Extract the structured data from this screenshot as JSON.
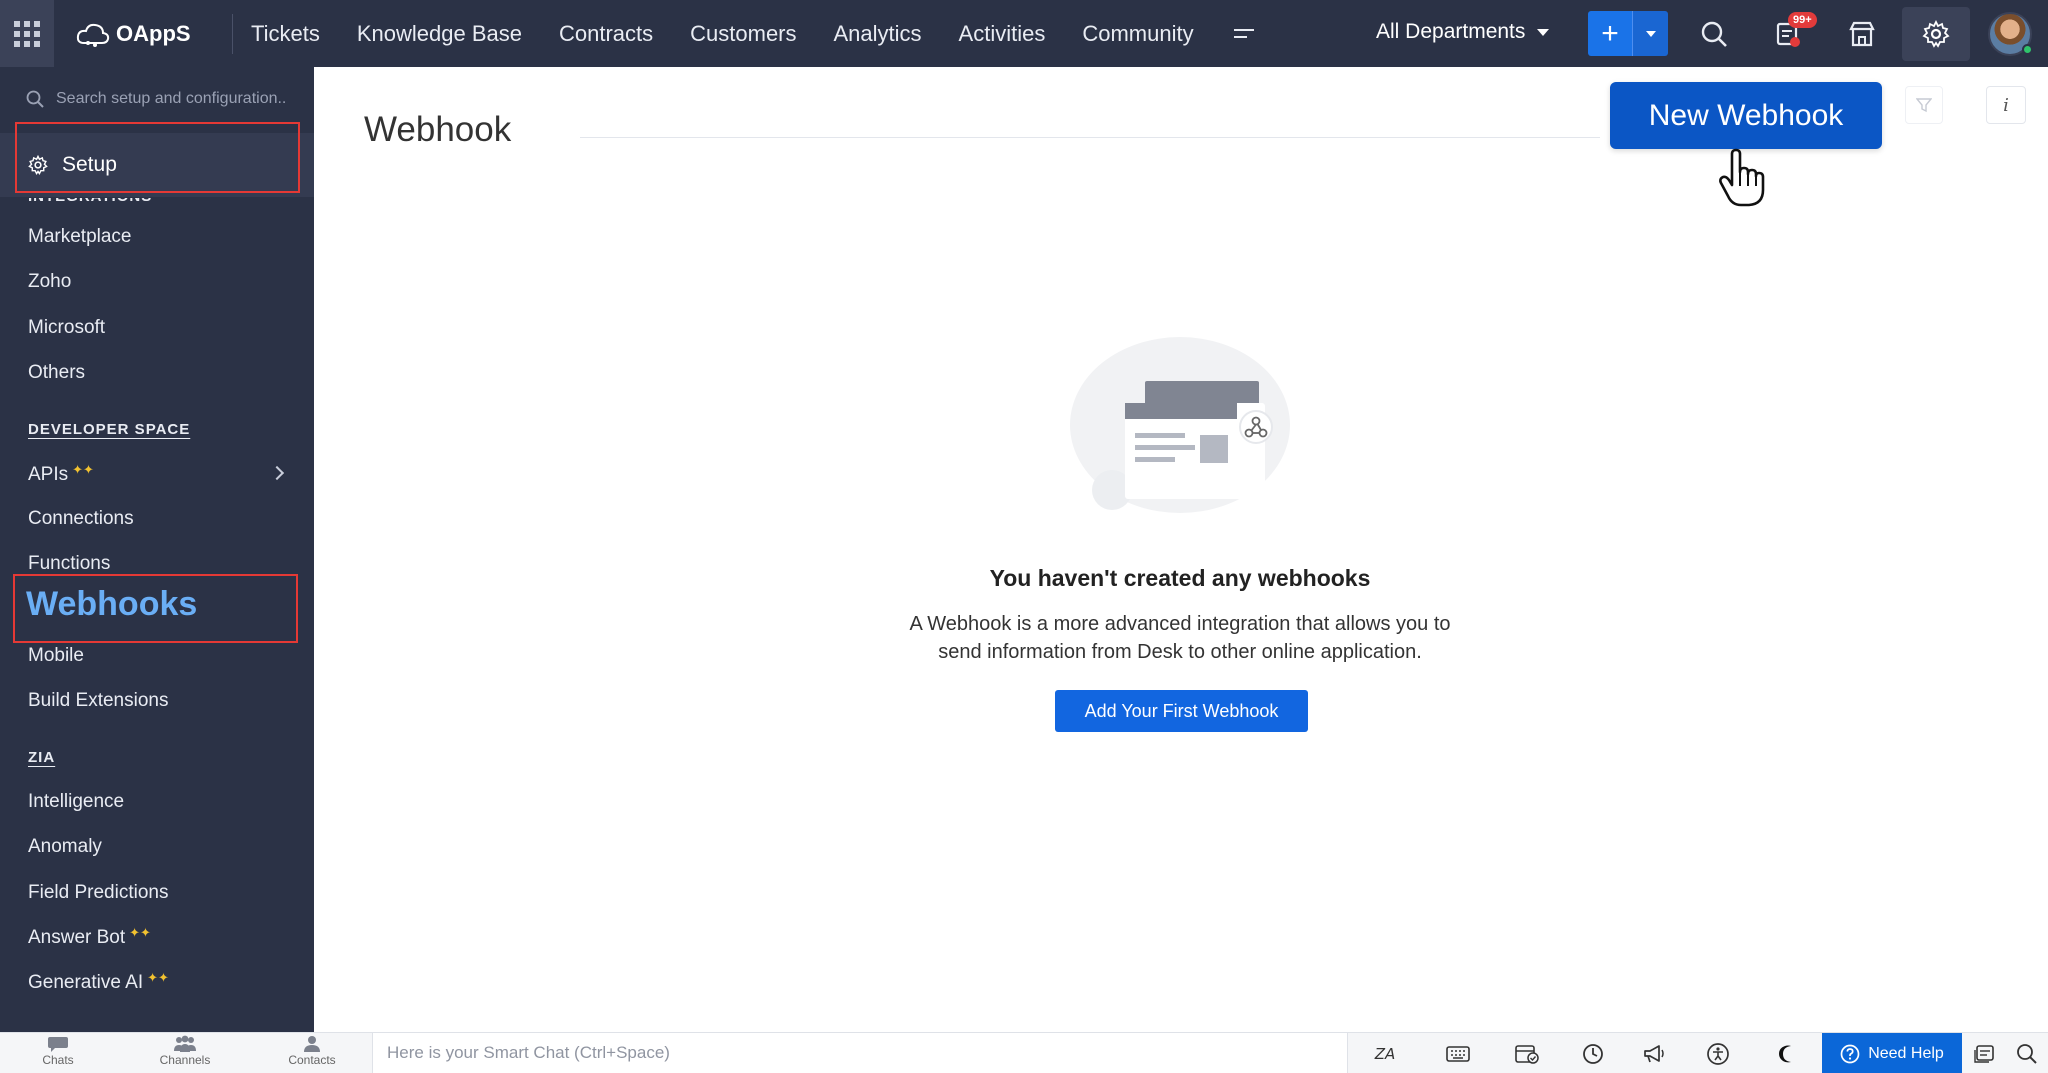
{
  "topbar": {
    "brand": "OAppS",
    "nav": [
      "Tickets",
      "Knowledge Base",
      "Contracts",
      "Customers",
      "Analytics",
      "Activities",
      "Community"
    ],
    "department": "All Departments",
    "add_label": "+",
    "notification_badge": "99+",
    "icons": [
      "apps-grid-icon",
      "search-icon",
      "notification-icon",
      "marketplace-icon",
      "gear-icon",
      "avatar"
    ]
  },
  "sidebar": {
    "search_placeholder": "Search setup and configuration..",
    "setup_label": "Setup",
    "sections": [
      {
        "head": "DEVELOPER SPACE"
      },
      {
        "head": "ZIA"
      }
    ],
    "integrations": [
      "Marketplace",
      "Zoho",
      "Microsoft",
      "Others"
    ],
    "developer": [
      "APIs",
      "Connections",
      "Functions",
      "Webhooks",
      "Mobile",
      "Build Extensions"
    ],
    "zia": [
      "Intelligence",
      "Anomaly",
      "Field Predictions",
      "Answer Bot",
      "Generative AI"
    ]
  },
  "main": {
    "title": "Webhook",
    "new_button": "New Webhook",
    "empty_title": "You haven't created any webhooks",
    "empty_desc_1": "A Webhook is a more advanced integration that allows you to",
    "empty_desc_2": "send information from Desk to other online application.",
    "first_button": "Add Your First Webhook"
  },
  "bottombar": {
    "tabs": [
      "Chats",
      "Channels",
      "Contacts"
    ],
    "smart_chat_placeholder": "Here is your Smart Chat (Ctrl+Space)",
    "need_help": "Need Help"
  },
  "colors": {
    "sidebar_bg": "#2b3246",
    "accent_blue": "#0b56c5",
    "highlight_red": "#e53935",
    "active_link": "#6aaef5"
  }
}
